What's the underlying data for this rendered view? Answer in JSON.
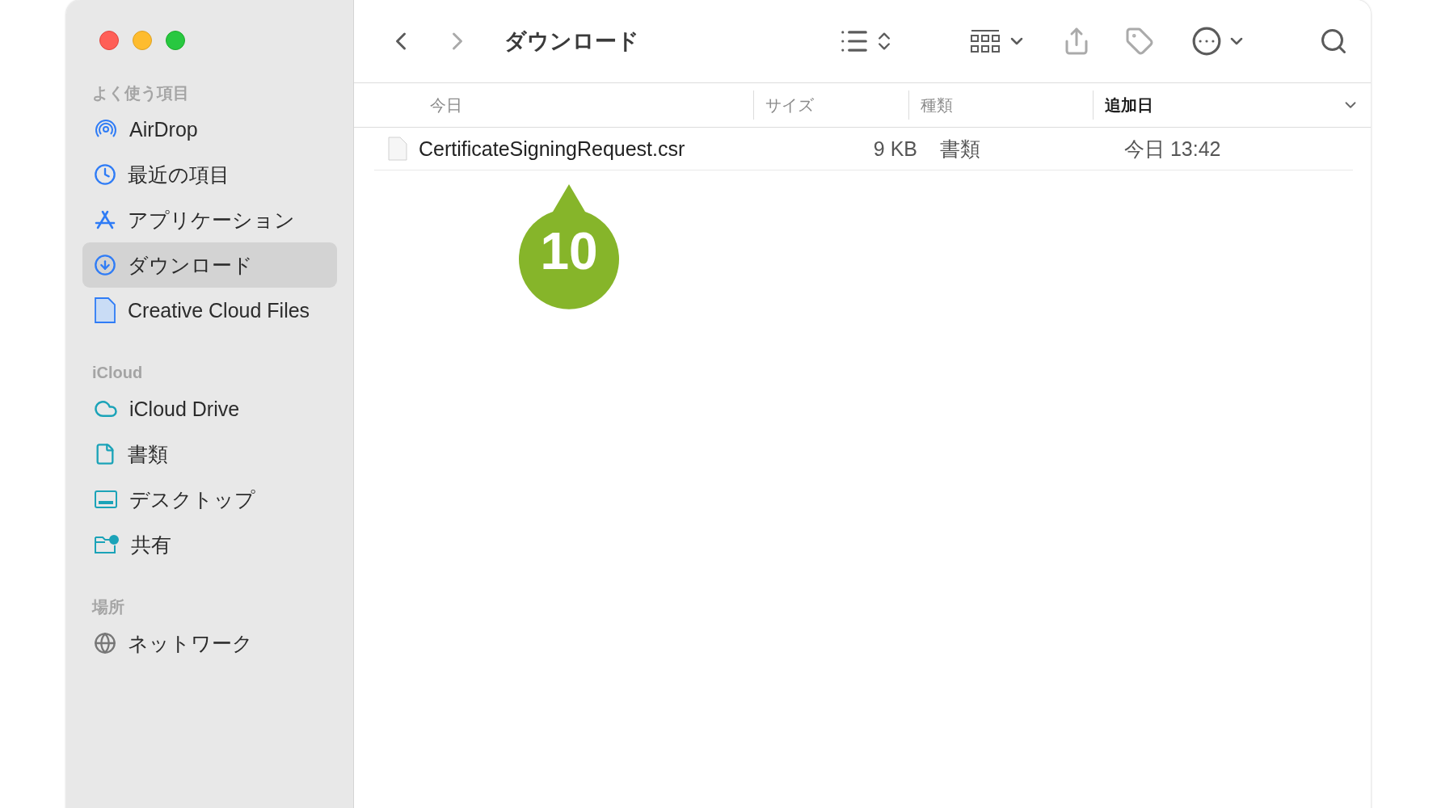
{
  "window": {
    "title": "ダウンロード"
  },
  "sidebar": {
    "sections": [
      {
        "heading": "よく使う項目",
        "items": [
          {
            "label": "AirDrop",
            "kind": "airdrop",
            "selected": false
          },
          {
            "label": "最近の項目",
            "kind": "clock",
            "selected": false
          },
          {
            "label": "アプリケーション",
            "kind": "apps",
            "selected": false
          },
          {
            "label": "ダウンロード",
            "kind": "download",
            "selected": true
          },
          {
            "label": "Creative Cloud Files",
            "kind": "file-blue",
            "selected": false
          }
        ]
      },
      {
        "heading": "iCloud",
        "items": [
          {
            "label": "iCloud Drive",
            "kind": "cloud",
            "selected": false
          },
          {
            "label": "書類",
            "kind": "document",
            "selected": false
          },
          {
            "label": "デスクトップ",
            "kind": "desktop",
            "selected": false
          },
          {
            "label": "共有",
            "kind": "shared",
            "selected": false
          }
        ]
      },
      {
        "heading": "場所",
        "items": [
          {
            "label": "ネットワーク",
            "kind": "globe",
            "selected": false
          }
        ]
      }
    ]
  },
  "table": {
    "columns": [
      {
        "label": "今日",
        "sorted": false
      },
      {
        "label": "サイズ",
        "sorted": false
      },
      {
        "label": "種類",
        "sorted": false
      },
      {
        "label": "追加日",
        "sorted": true
      }
    ],
    "rows": [
      {
        "name": "CertificateSigningRequest.csr",
        "size": "9 KB",
        "kind": "書類",
        "date_added": "今日 13:42"
      }
    ]
  },
  "callout": {
    "label": "10"
  }
}
